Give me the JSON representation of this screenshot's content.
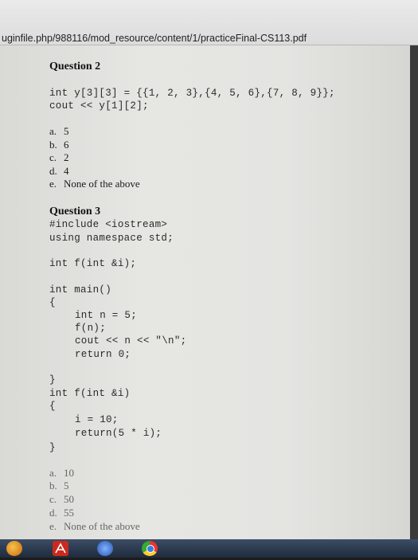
{
  "browser": {
    "url": "uginfile.php/988116/mod_resource/content/1/practiceFinal-CS113.pdf"
  },
  "question2": {
    "title": "Question 2",
    "code": [
      "int y[3][3] = {{1, 2, 3},{4, 5, 6},{7, 8, 9}};",
      "cout << y[1][2];"
    ],
    "options": [
      {
        "letter": "a.",
        "text": "5"
      },
      {
        "letter": "b.",
        "text": "6"
      },
      {
        "letter": "c.",
        "text": "2"
      },
      {
        "letter": "d.",
        "text": "4"
      },
      {
        "letter": "e.",
        "text": "None of the above"
      }
    ]
  },
  "question3": {
    "title": "Question 3",
    "code": [
      "#include <iostream>",
      "using namespace std;",
      "int f(int &i);",
      "int main()",
      "{",
      "int n = 5;",
      "f(n);",
      "cout << n << \"\\n\";",
      "return 0;",
      "}",
      "int f(int &i)",
      "{",
      "i = 10;",
      "return(5 * i);",
      "}"
    ],
    "options": [
      {
        "letter": "a.",
        "text": "10"
      },
      {
        "letter": "b.",
        "text": "5"
      },
      {
        "letter": "c.",
        "text": "50"
      },
      {
        "letter": "d.",
        "text": "55"
      },
      {
        "letter": "e.",
        "text": "None of the above"
      }
    ]
  },
  "taskbar": {
    "icons": [
      "ie-icon",
      "pdf-reader-icon",
      "media-icon",
      "chrome-icon"
    ]
  }
}
